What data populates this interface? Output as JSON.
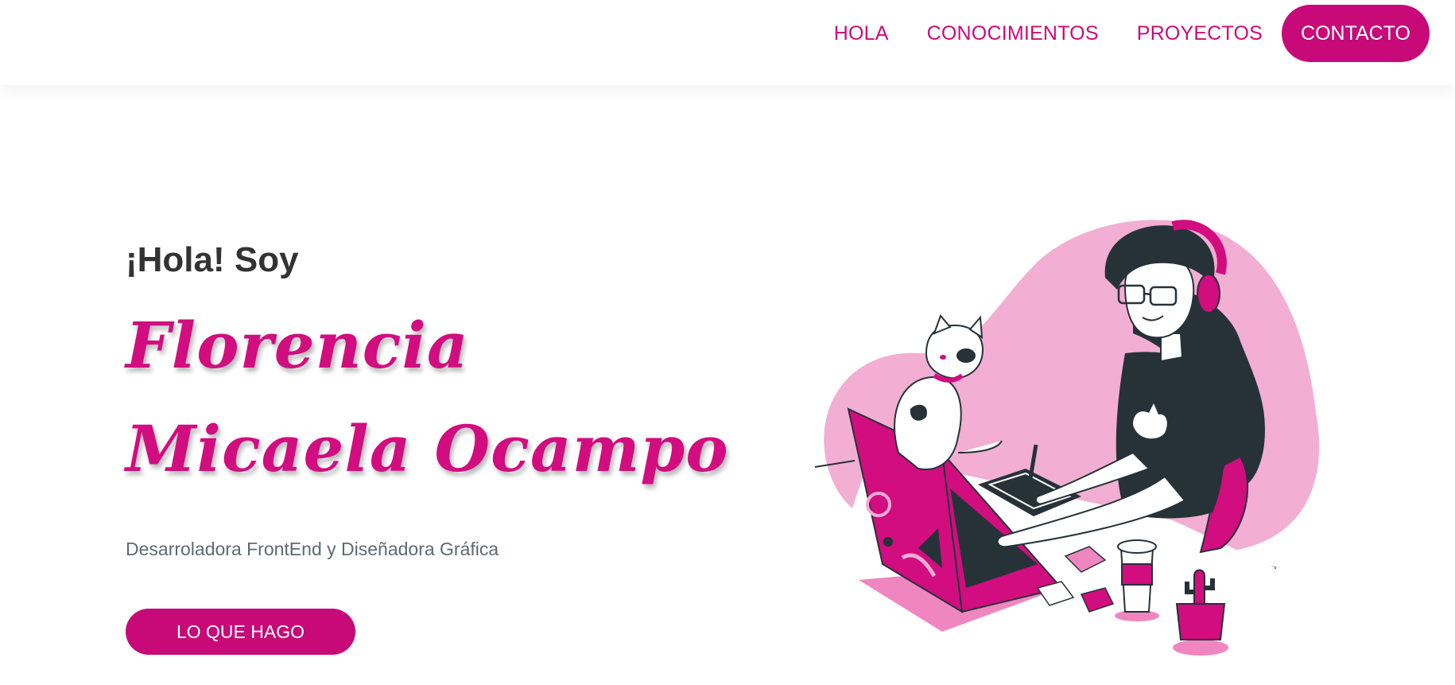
{
  "nav": {
    "items": [
      {
        "label": "HOLA"
      },
      {
        "label": "CONOCIMIENTOS"
      },
      {
        "label": "PROYECTOS"
      }
    ],
    "cta_label": "CONTACTO"
  },
  "hero": {
    "greeting": "¡Hola! Soy",
    "name_line_1": "Florencia",
    "name_line_2": "Micaela Ocampo",
    "subtitle": "Desarroladora FrontEnd y Diseñadora Gráfica",
    "button_label": "LO QUE HAGO"
  },
  "colors": {
    "accent": "#c70a78",
    "accent_light": "#f2aed3",
    "dark": "#263238",
    "text": "#333333"
  },
  "icons": [
    "woman-at-laptop-illustration",
    "cat-illustration",
    "headphones-icon",
    "coffee-cup-icon",
    "cactus-icon",
    "drawing-tablet-icon"
  ]
}
